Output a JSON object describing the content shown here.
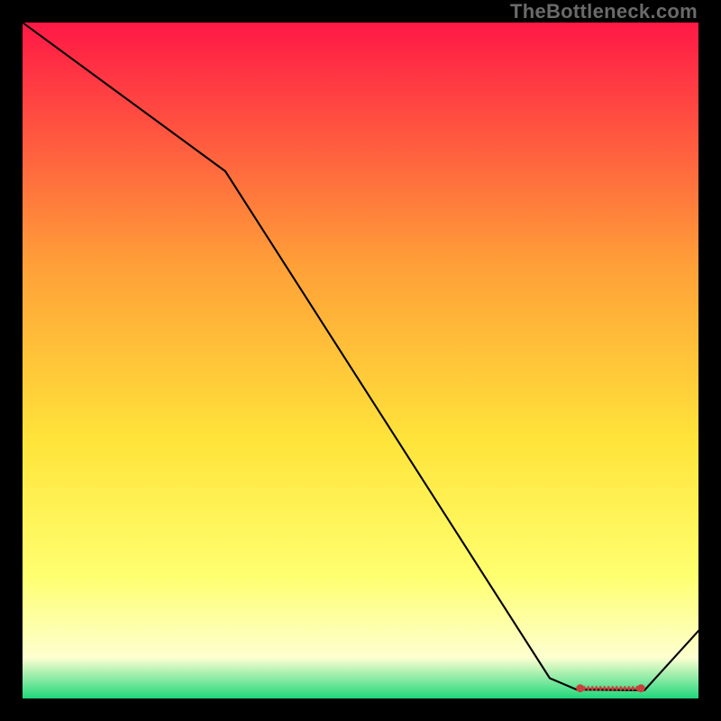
{
  "watermark": "TheBottleneck.com",
  "chart_data": {
    "type": "line",
    "title": "",
    "xlabel": "",
    "ylabel": "",
    "xlim": [
      0,
      100
    ],
    "ylim": [
      0,
      100
    ],
    "grid": false,
    "legend": false,
    "background_gradient": {
      "top": "#ff1846",
      "mid_upper": "#ffa038",
      "mid": "#ffe43a",
      "mid_lower": "#ffff70",
      "near_bottom": "#fdffd0",
      "bottom": "#20d77b"
    },
    "series": [
      {
        "name": "bottleneck-curve",
        "color": "#000000",
        "x": [
          0,
          30,
          78,
          82,
          92,
          100
        ],
        "y": [
          100,
          78,
          3,
          1.3,
          1.2,
          10
        ]
      }
    ],
    "markers": {
      "name": "tick-row",
      "color": "#c9413f",
      "y": 1.5,
      "x_start": 82.5,
      "x_end": 91.5,
      "count": 14,
      "endpoint_radius": 0.6,
      "tick_height": 0.7
    }
  }
}
